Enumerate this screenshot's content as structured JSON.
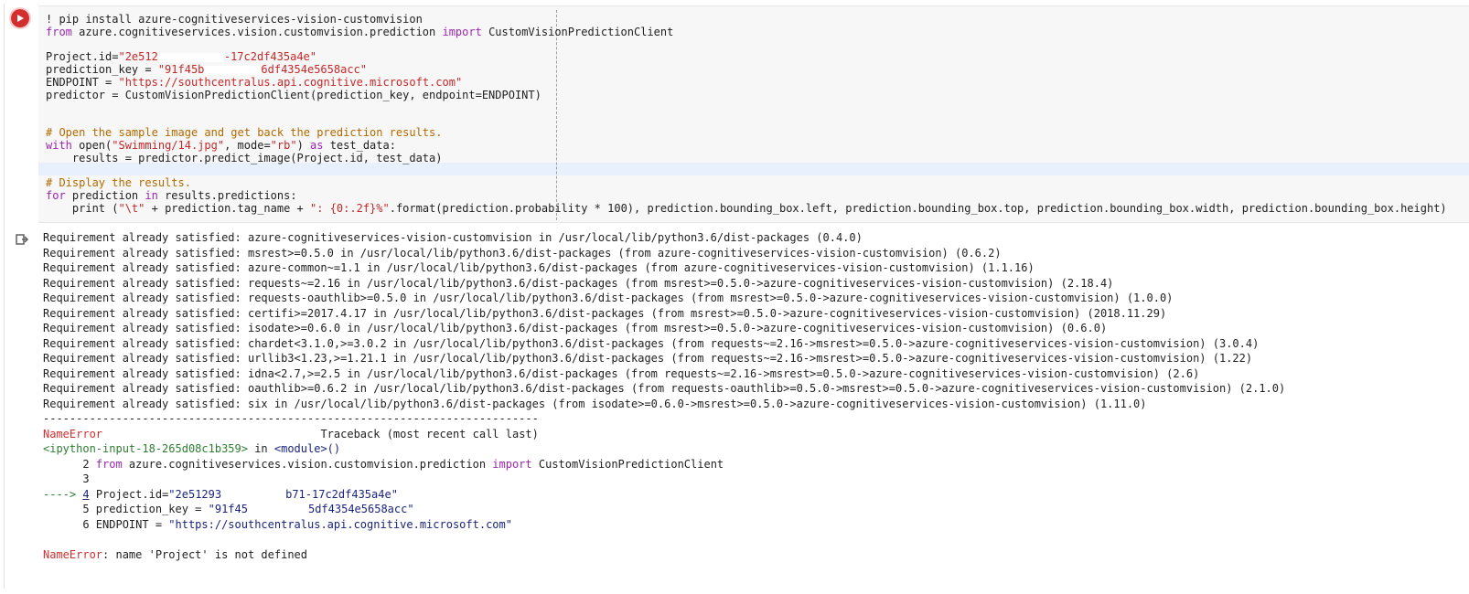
{
  "cell": {
    "run_icon": "play-icon",
    "output_icon": "output-redirect-icon",
    "code": {
      "l1_bang": "! pip install azure-cognitiveservices-vision-customvision",
      "l2_from": "from",
      "l2_mod": " azure.cognitiveservices.vision.customvision.prediction ",
      "l2_import": "import",
      "l2_cls": " CustomVisionPredictionClient",
      "l4_lhs": "Project.id=",
      "l4_s1": "\"2e512",
      "l4_s2": "-17c2df435a4e\"",
      "l5_lhs": "prediction_key = ",
      "l5_s1": "\"91f45b",
      "l5_s2": "6df4354e5658acc\"",
      "l6_lhs": "ENDPOINT = ",
      "l6_val": "\"https://southcentralus.api.cognitive.microsoft.com\"",
      "l7": "predictor = CustomVisionPredictionClient(prediction_key, endpoint=ENDPOINT)",
      "l10_comment": "# Open the sample image and get back the prediction results.",
      "l11_with": "with",
      "l11_open": " open(",
      "l11_path": "\"Swimming/14.jpg\"",
      "l11_mid": ", mode=",
      "l11_mode": "\"rb\"",
      "l11_close": ") ",
      "l11_as": "as",
      "l11_var": " test_data:",
      "l12": "    results = predictor.predict_image(Project.id, test_data)",
      "l14_comment": "# Display the results.",
      "l15_for": "for",
      "l15_mid": " prediction ",
      "l15_in": "in",
      "l15_end": " results.predictions:",
      "l16_a": "    print (",
      "l16_s1": "\"\\t\"",
      "l16_b": " + prediction.tag_name + ",
      "l16_s2": "\": {0:.2f}%\"",
      "l16_c": ".format(prediction.probability * 100), prediction.bounding_box.left, prediction.bounding_box.top, prediction.bounding_box.width, prediction.bounding_box.height)"
    }
  },
  "output": {
    "requirements": [
      "Requirement already satisfied: azure-cognitiveservices-vision-customvision in /usr/local/lib/python3.6/dist-packages (0.4.0)",
      "Requirement already satisfied: msrest>=0.5.0 in /usr/local/lib/python3.6/dist-packages (from azure-cognitiveservices-vision-customvision) (0.6.2)",
      "Requirement already satisfied: azure-common~=1.1 in /usr/local/lib/python3.6/dist-packages (from azure-cognitiveservices-vision-customvision) (1.1.16)",
      "Requirement already satisfied: requests~=2.16 in /usr/local/lib/python3.6/dist-packages (from msrest>=0.5.0->azure-cognitiveservices-vision-customvision) (2.18.4)",
      "Requirement already satisfied: requests-oauthlib>=0.5.0 in /usr/local/lib/python3.6/dist-packages (from msrest>=0.5.0->azure-cognitiveservices-vision-customvision) (1.0.0)",
      "Requirement already satisfied: certifi>=2017.4.17 in /usr/local/lib/python3.6/dist-packages (from msrest>=0.5.0->azure-cognitiveservices-vision-customvision) (2018.11.29)",
      "Requirement already satisfied: isodate>=0.6.0 in /usr/local/lib/python3.6/dist-packages (from msrest>=0.5.0->azure-cognitiveservices-vision-customvision) (0.6.0)",
      "Requirement already satisfied: chardet<3.1.0,>=3.0.2 in /usr/local/lib/python3.6/dist-packages (from requests~=2.16->msrest>=0.5.0->azure-cognitiveservices-vision-customvision) (3.0.4)",
      "Requirement already satisfied: urllib3<1.23,>=1.21.1 in /usr/local/lib/python3.6/dist-packages (from requests~=2.16->msrest>=0.5.0->azure-cognitiveservices-vision-customvision) (1.22)",
      "Requirement already satisfied: idna<2.7,>=2.5 in /usr/local/lib/python3.6/dist-packages (from requests~=2.16->msrest>=0.5.0->azure-cognitiveservices-vision-customvision) (2.6)",
      "Requirement already satisfied: oauthlib>=0.6.2 in /usr/local/lib/python3.6/dist-packages (from requests-oauthlib>=0.5.0->msrest>=0.5.0->azure-cognitiveservices-vision-customvision) (2.1.0)",
      "Requirement already satisfied: six in /usr/local/lib/python3.6/dist-packages (from isodate>=0.6.0->msrest>=0.5.0->azure-cognitiveservices-vision-customvision) (1.11.0)"
    ],
    "separator": "---------------------------------------------------------------------------",
    "tb_error_name": "NameError",
    "tb_header_pad": "                                 ",
    "tb_header": "Traceback (most recent call last)",
    "tb_input": "<ipython-input-18-265d08c1b359>",
    "tb_in": " in ",
    "tb_module": "<module>()",
    "tb_l2_num": "      2 ",
    "tb_l2_from": "from",
    "tb_l2_mid": " azure.cognitiveservices.vision.customvision.prediction ",
    "tb_l2_import": "import",
    "tb_l2_cls": " CustomVisionPredictionClient",
    "tb_l3": "      3",
    "tb_l4_arrow": "----> ",
    "tb_l4_num": "4",
    "tb_l4_lhs": " Project.id=",
    "tb_l4_val1": "\"2e51293",
    "tb_l4_val2": "b71-17c2df435a4e\"",
    "tb_l5_num": "      5 ",
    "tb_l5_lhs": "prediction_key = ",
    "tb_l5_val1": "\"91f45",
    "tb_l5_val2": "5df4354e5658acc\"",
    "tb_l6_num": "      6 ",
    "tb_l6_lhs": "ENDPOINT = ",
    "tb_l6_val": "\"https://southcentralus.api.cognitive.microsoft.com\"",
    "final_error_name": "NameError",
    "final_error_msg": ": name 'Project' is not defined"
  }
}
